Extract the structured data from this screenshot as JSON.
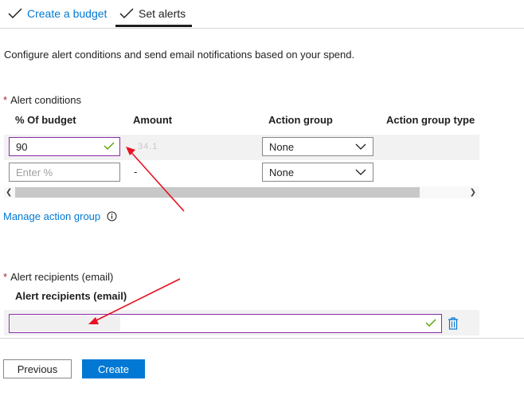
{
  "tabs": [
    {
      "label": "Create a budget",
      "state": "completed"
    },
    {
      "label": "Set alerts",
      "state": "active"
    }
  ],
  "description": "Configure alert conditions and send email notifications based on your spend.",
  "alert_conditions": {
    "section_label": "Alert conditions",
    "columns": [
      "% Of budget",
      "Amount",
      "Action group",
      "Action group type"
    ],
    "rows": [
      {
        "percent": "90",
        "amount": "34.1",
        "action_group": "None"
      },
      {
        "percent": "",
        "percent_placeholder": "Enter %",
        "amount": "-",
        "action_group": "None"
      }
    ]
  },
  "manage_action_group": "Manage action group",
  "alert_recipients": {
    "section_label": "Alert recipients (email)",
    "column": "Alert recipients (email)",
    "value": ""
  },
  "buttons": {
    "previous": "Previous",
    "create": "Create"
  },
  "colors": {
    "accent": "#0078d4",
    "valid_border": "#8a2da5",
    "check_green": "#57a300",
    "annotation_arrow": "#e81123",
    "required": "#a4262c"
  }
}
